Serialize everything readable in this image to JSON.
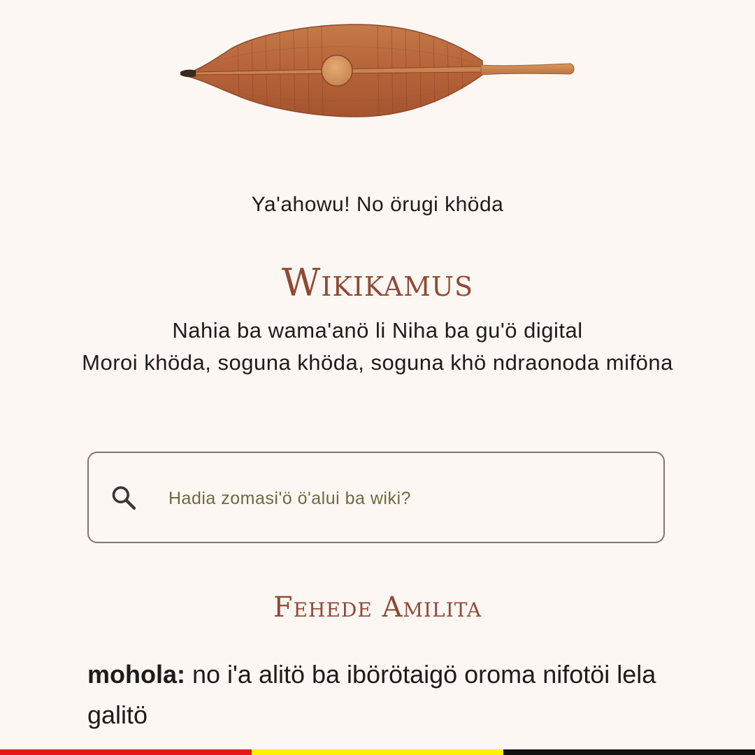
{
  "hero": {
    "image_name": "traditional-wooden-paddle-illustration"
  },
  "greeting": "Ya'ahowu! No örugi khöda",
  "app_title": "Wikikamus",
  "tagline": {
    "line1": "Nahia ba wama'anö li Niha ba gu'ö digital",
    "line2": "Moroi khöda, soguna khöda, soguna khö ndraonoda miföna"
  },
  "search": {
    "placeholder": "Hadia zomasi'ö ö'alui ba wiki?",
    "value": "",
    "icon": "search-icon"
  },
  "featured_section": {
    "title": "Fehede Amilita",
    "word": "mohola:",
    "definition": " no i'a alitö ba ibörötaigö oroma nifotöi lela galitö"
  },
  "flag_colors": [
    "#e8161b",
    "#fff200",
    "#111111"
  ],
  "colors": {
    "background": "#fdf7f4",
    "accent": "#8e4a34",
    "text": "#201a19",
    "placeholder": "#6f6a3c",
    "border": "#85736e"
  }
}
